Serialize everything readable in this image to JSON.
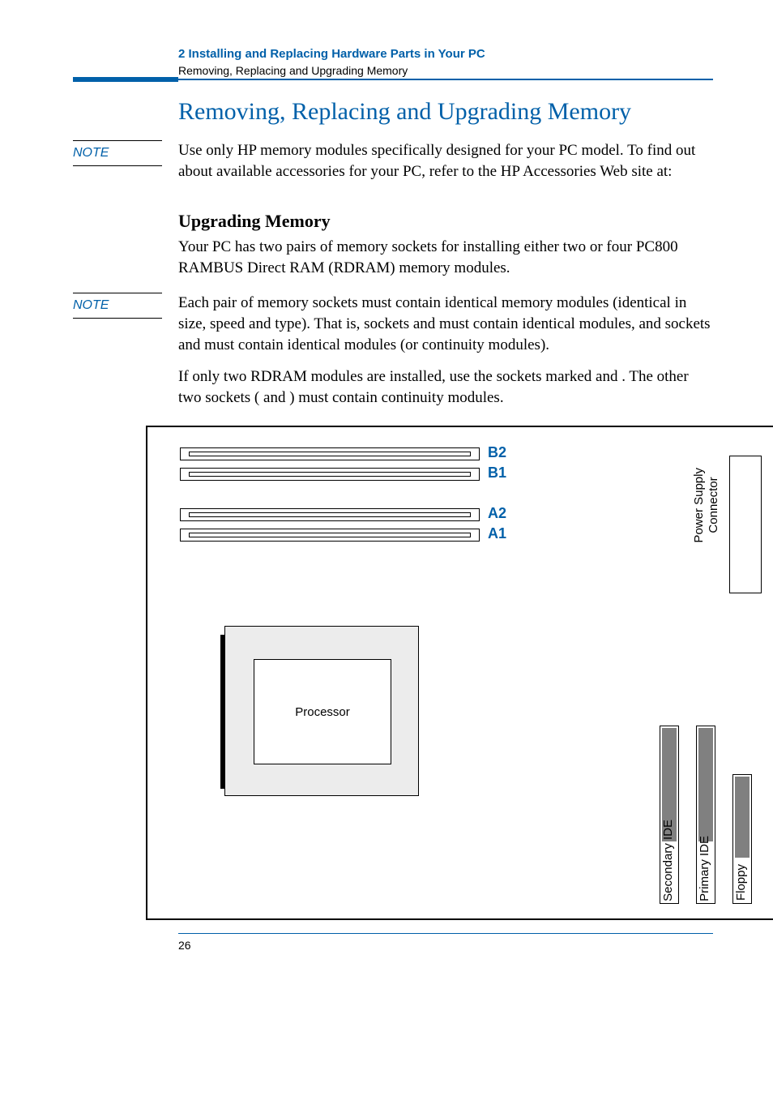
{
  "header": {
    "chapter": "2   Installing and Replacing Hardware Parts in Your PC",
    "subtitle": "Removing, Replacing and Upgrading Memory"
  },
  "title": "Removing, Replacing and Upgrading Memory",
  "note1": {
    "label": "NOTE",
    "text": "Use only HP memory modules specifically designed for your PC model. To find out about available accessories for your PC, refer to the HP Accessories Web site at:"
  },
  "section": {
    "heading": "Upgrading Memory",
    "intro": "Your PC has two pairs of memory sockets for installing either two or four PC800 RAMBUS Direct RAM (RDRAM) memory modules."
  },
  "note2": {
    "label": "NOTE",
    "text": "Each pair of memory sockets must contain identical memory modules (identical in size, speed and type). That is, sockets       and       must contain identical modules, and sockets       and       must contain identical modules (or continuity modules)."
  },
  "para_after": "If only two RDRAM modules are installed, use the sockets marked       and       . The other two sockets (       and       ) must contain continuity modules.",
  "diagram": {
    "slots": {
      "b2": "B2",
      "b1": "B1",
      "a2": "A2",
      "a1": "A1"
    },
    "processor": "Processor",
    "psu": "Power Supply\nConnector",
    "secondary_ide": "Secondary IDE",
    "primary_ide": "Primary  IDE",
    "floppy": "Floppy"
  },
  "page_number": "26"
}
